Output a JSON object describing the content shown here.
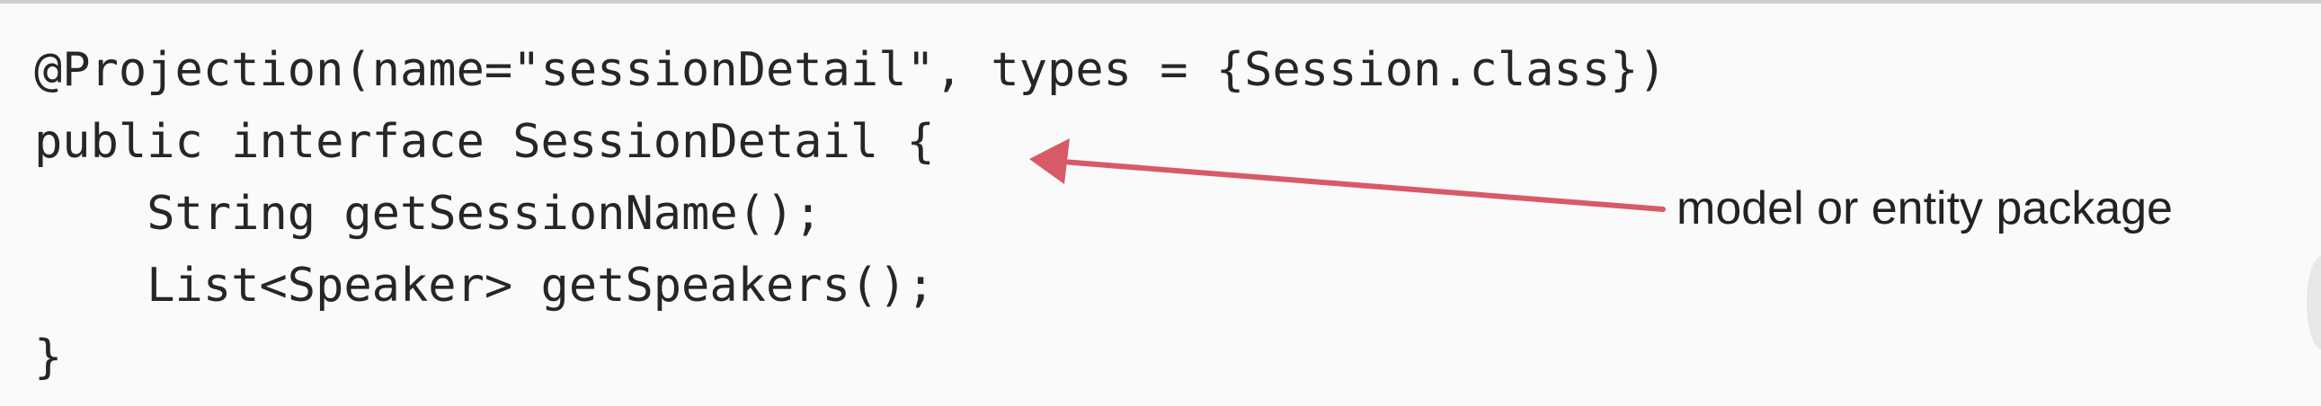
{
  "code": {
    "lines": [
      "@Projection(name=\"sessionDetail\", types = {Session.class})",
      "public interface SessionDetail {",
      "    String getSessionName();",
      "    List<Speaker> getSpeakers();",
      "}"
    ]
  },
  "annotation": {
    "label": "model or entity package",
    "color": "#d85a67"
  }
}
